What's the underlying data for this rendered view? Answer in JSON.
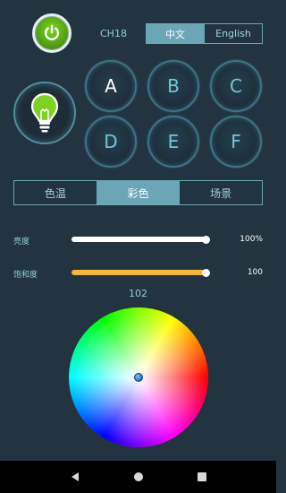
{
  "header": {
    "channel": "CH18",
    "language_options": [
      "中文",
      "English"
    ],
    "language_selected": "中文"
  },
  "channels": {
    "items": [
      "A",
      "B",
      "C",
      "D",
      "E",
      "F"
    ],
    "selected": "A"
  },
  "modes": {
    "items": [
      "色温",
      "彩色",
      "场景"
    ],
    "selected": "彩色"
  },
  "brightness": {
    "label": "亮度",
    "value_text": "100%",
    "level": 1.0,
    "color": "#ffffff"
  },
  "saturation": {
    "label": "饱和度",
    "value_text": "100",
    "level": 1.0,
    "color": "#f5b73b"
  },
  "color_wheel": {
    "value_text": "102"
  },
  "icons": {
    "power": "power-icon",
    "bulb": "lightbulb-icon",
    "back": "back-icon",
    "home": "home-icon",
    "recents": "recents-icon"
  },
  "colors": {
    "background": "#223440",
    "accent": "#6ba6b6",
    "bulb_green": "#7ed321"
  }
}
